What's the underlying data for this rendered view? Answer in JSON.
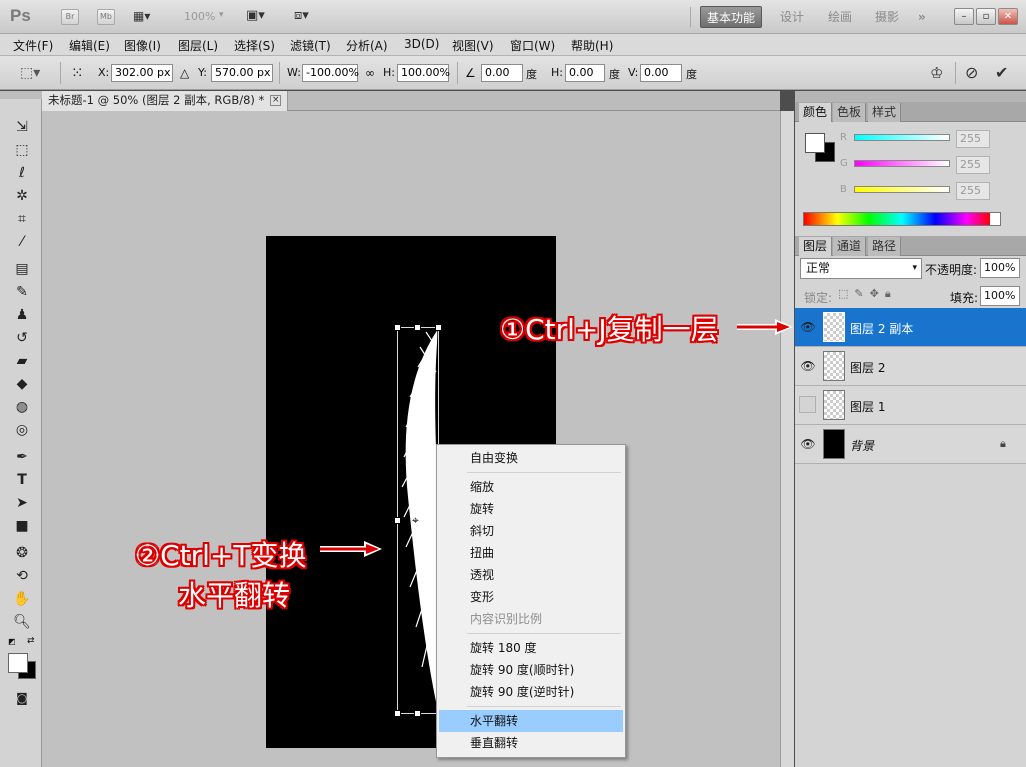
{
  "app": {
    "logo": "Ps",
    "bridge_chip": "Br",
    "minibridge_chip": "Mb",
    "zoom": "100%",
    "workspaces": [
      "基本功能",
      "设计",
      "绘画",
      "摄影"
    ],
    "more": "»"
  },
  "menu": [
    "文件(F)",
    "编辑(E)",
    "图像(I)",
    "图层(L)",
    "选择(S)",
    "滤镜(T)",
    "分析(A)",
    "3D(D)",
    "视图(V)",
    "窗口(W)",
    "帮助(H)"
  ],
  "options": {
    "x_label": "X:",
    "x_value": "302.00 px",
    "y_label": "Y:",
    "y_value": "570.00 px",
    "w_label": "W:",
    "w_value": "-100.00%",
    "h_label": "H:",
    "h_value": "100.00%",
    "angle_value": "0.00",
    "angle_unit": "度",
    "hskew_label": "H:",
    "hskew_value": "0.00",
    "hskew_unit": "度",
    "vskew_label": "V:",
    "vskew_value": "0.00",
    "vskew_unit": "度"
  },
  "document": {
    "tab_title": "未标题-1 @ 50% (图层 2 副本, RGB/8) *",
    "close": "×"
  },
  "context_menu": [
    {
      "label": "自由变换"
    },
    {
      "label": "缩放"
    },
    {
      "label": "旋转"
    },
    {
      "label": "斜切"
    },
    {
      "label": "扭曲"
    },
    {
      "label": "透视"
    },
    {
      "label": "变形"
    },
    {
      "label": "内容识别比例"
    },
    {
      "label": "旋转 180 度"
    },
    {
      "label": "旋转 90 度(顺时针)"
    },
    {
      "label": "旋转 90 度(逆时针)"
    },
    {
      "label": "水平翻转"
    },
    {
      "label": "垂直翻转"
    }
  ],
  "annotations": {
    "step1": "①Ctrl+J复制一层",
    "step2_line1": "②Ctrl+T变换",
    "step2_line2": "水平翻转",
    "color": "#dd0000"
  },
  "color_panel": {
    "tabs": [
      "颜色",
      "色板",
      "样式"
    ],
    "r_label": "R",
    "r_value": "255",
    "g_label": "G",
    "g_value": "255",
    "b_label": "B",
    "b_value": "255"
  },
  "layers_panel": {
    "tabs": [
      "图层",
      "通道",
      "路径"
    ],
    "blend_mode": "正常",
    "opacity_label": "不透明度:",
    "opacity_value": "100%",
    "lock_label": "锁定:",
    "fill_label": "填充:",
    "fill_value": "100%",
    "layers": [
      {
        "name": "图层 2 副本",
        "visible": true,
        "selected": true
      },
      {
        "name": "图层 2",
        "visible": true,
        "selected": false
      },
      {
        "name": "图层 1",
        "visible": false,
        "selected": false
      },
      {
        "name": "背景",
        "visible": true,
        "selected": false,
        "locked": true
      }
    ]
  }
}
